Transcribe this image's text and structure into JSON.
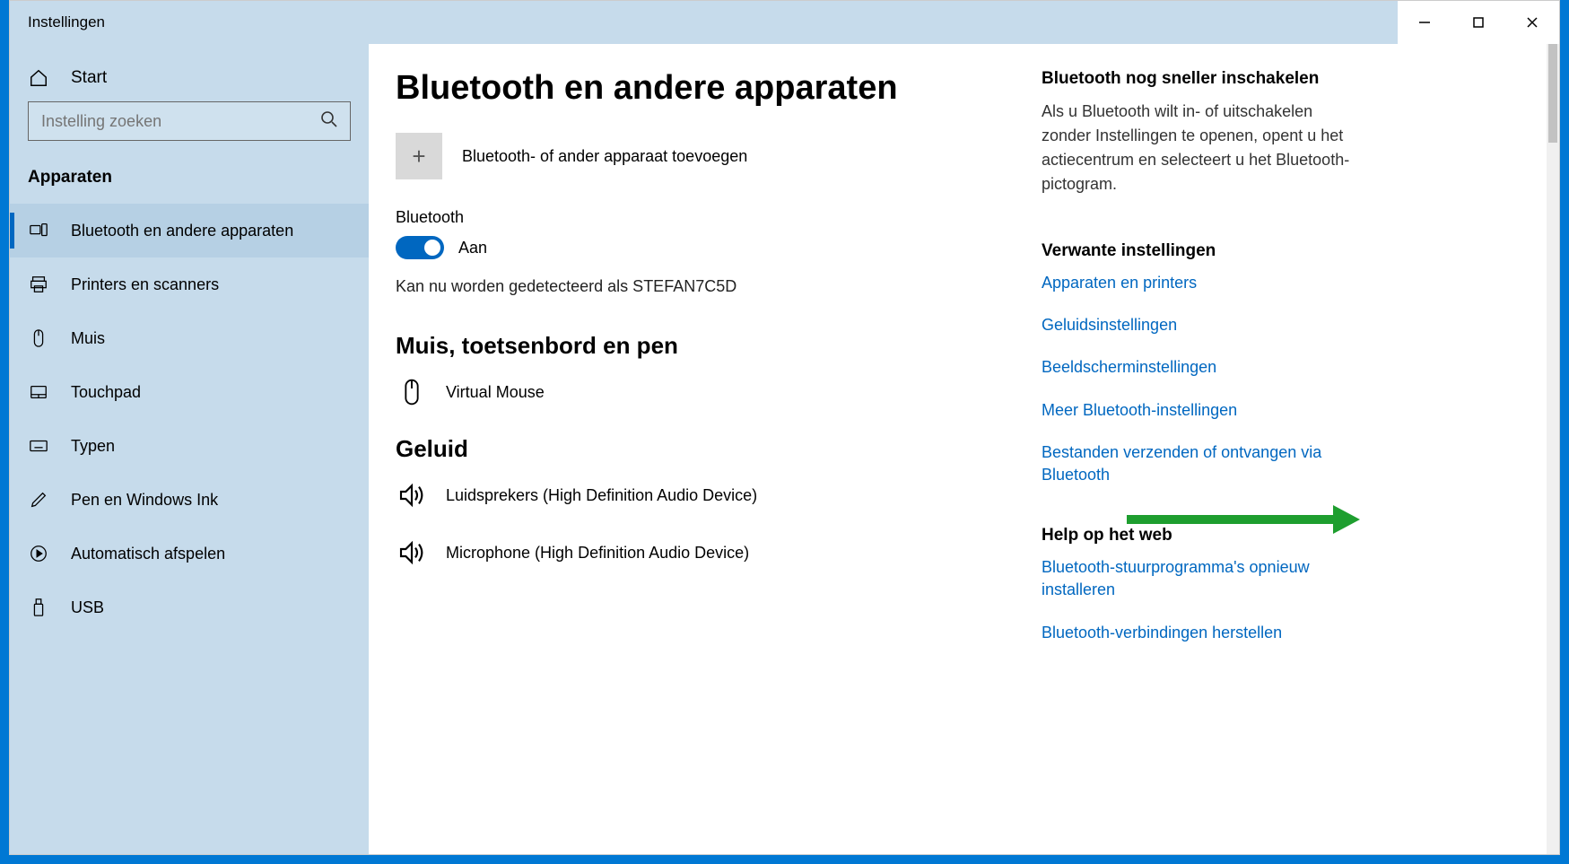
{
  "window": {
    "title": "Instellingen"
  },
  "sidebar": {
    "home_label": "Start",
    "search_placeholder": "Instelling zoeken",
    "section_label": "Apparaten",
    "items": [
      {
        "label": "Bluetooth en andere apparaten"
      },
      {
        "label": "Printers en scanners"
      },
      {
        "label": "Muis"
      },
      {
        "label": "Touchpad"
      },
      {
        "label": "Typen"
      },
      {
        "label": "Pen en Windows Ink"
      },
      {
        "label": "Automatisch afspelen"
      },
      {
        "label": "USB"
      }
    ]
  },
  "main": {
    "page_title": "Bluetooth en andere apparaten",
    "add_device_label": "Bluetooth- of ander apparaat toevoegen",
    "bluetooth_label": "Bluetooth",
    "toggle_state": "Aan",
    "detect_status": "Kan nu worden gedetecteerd als STEFAN7C5D",
    "group_mouse_title": "Muis, toetsenbord en pen",
    "device_mouse": "Virtual Mouse",
    "group_audio_title": "Geluid",
    "device_speaker": "Luidsprekers (High Definition Audio Device)",
    "device_mic": "Microphone (High Definition Audio Device)"
  },
  "aside": {
    "tip_title": "Bluetooth nog sneller inschakelen",
    "tip_body": "Als u Bluetooth wilt in- of uitschakelen zonder Instellingen te openen, opent u het actiecentrum en selecteert u het Bluetooth-pictogram.",
    "related_title": "Verwante instellingen",
    "links": [
      "Apparaten en printers",
      "Geluidsinstellingen",
      "Beeldscherminstellingen",
      "Meer Bluetooth-instellingen",
      "Bestanden verzenden of ontvangen via Bluetooth"
    ],
    "help_title": "Help op het web",
    "help_links": [
      "Bluetooth-stuurprogramma's opnieuw installeren",
      "Bluetooth-verbindingen herstellen"
    ]
  },
  "colors": {
    "accent": "#0067c0",
    "annotation": "#1e9e2f"
  }
}
